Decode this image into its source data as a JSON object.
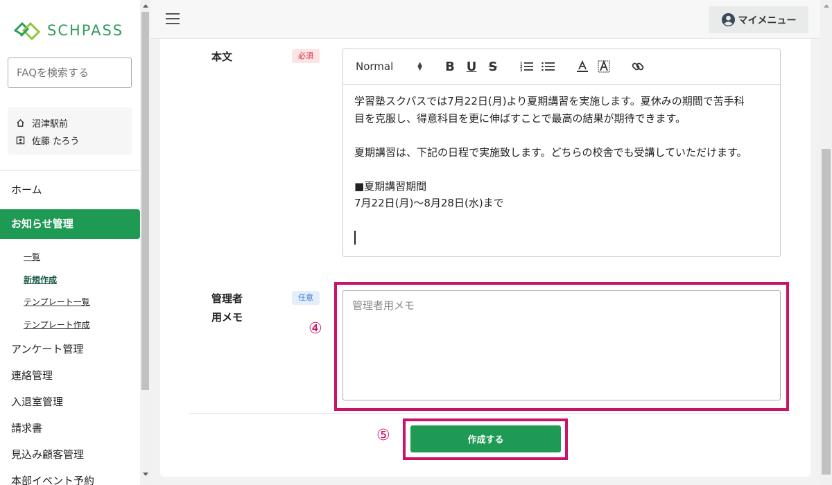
{
  "brand": {
    "name": "SCHPASS",
    "color": "#2f9d5e"
  },
  "sidebar": {
    "faq_placeholder": "FAQを検索する",
    "school": "沼津駅前",
    "user": "佐藤 たろう",
    "nav": {
      "home": "ホーム",
      "news": "お知らせ管理",
      "sub": [
        "一覧",
        "新規作成",
        "テンプレート一覧",
        "テンプレート作成"
      ],
      "survey": "アンケート管理",
      "contact": "連絡管理",
      "attendance": "入退室管理",
      "invoice": "請求書",
      "prospects": "見込み顧客管理",
      "events": "本部イベント予約"
    }
  },
  "header": {
    "my_menu": "マイメニュー"
  },
  "form": {
    "body_label": "本文",
    "required_badge": "必須",
    "optional_badge": "任意",
    "memo_label_1": "管理者",
    "memo_label_2": "用メモ",
    "memo_placeholder": "管理者用メモ",
    "editor": {
      "format": "Normal",
      "lines": [
        "学習塾スクパスでは7月22日(月)より夏期講習を実施します。夏休みの期間で苦手科",
        "目を克服し、得意科目を更に伸ばすことで最高の結果が期待できます。",
        "",
        "夏期講習は、下記の日程で実施致します。どちらの校舎でも受講していただけます。",
        "",
        "■夏期講習期間",
        "7月22日(月)〜8月28日(水)まで",
        ""
      ]
    },
    "submit": "作成する"
  },
  "annotations": {
    "step4": "④",
    "step5": "⑤",
    "color": "#cc1267"
  },
  "accent": "#1f9a55"
}
